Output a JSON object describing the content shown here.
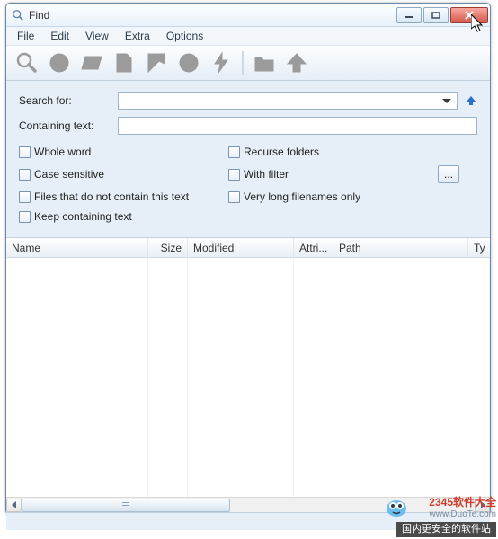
{
  "window": {
    "title": "Find"
  },
  "menu": {
    "file": "File",
    "edit": "Edit",
    "view": "View",
    "extra": "Extra",
    "options": "Options"
  },
  "search": {
    "search_for_label": "Search for:",
    "containing_text_label": "Containing text:",
    "search_for_value": "",
    "containing_text_value": ""
  },
  "checks": {
    "whole_word": "Whole word",
    "recurse_folders": "Recurse folders",
    "case_sensitive": "Case sensitive",
    "with_filter": "With filter",
    "files_not_contain": "Files that do not contain this text",
    "very_long_filenames": "Very long filenames only",
    "keep_containing": "Keep containing text"
  },
  "filter_button_label": "...",
  "columns": {
    "name": "Name",
    "size": "Size",
    "modified": "Modified",
    "attri": "Attri...",
    "path": "Path",
    "ty": "Ty"
  },
  "watermark": {
    "brand": "2345软件大全",
    "url": "www.DuoTe.com",
    "footer": "国内更安全的软件站"
  }
}
